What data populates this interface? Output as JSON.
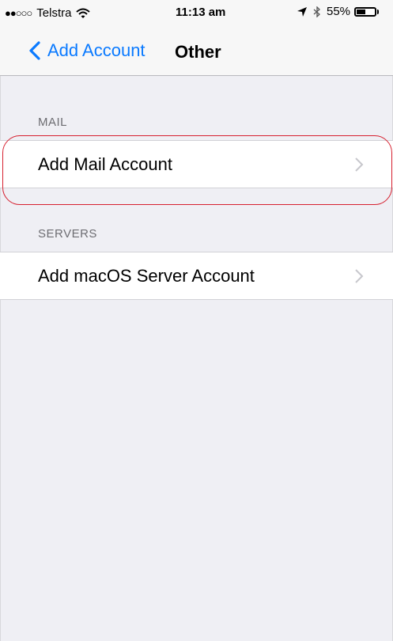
{
  "status_bar": {
    "signal": "●●○○○",
    "carrier": "Telstra",
    "time": "11:13 am",
    "battery": "55%",
    "battery_level": 0.55,
    "icons": [
      "wifi-icon",
      "location-icon",
      "bluetooth-icon",
      "battery-icon"
    ]
  },
  "nav": {
    "back_label": "Add Account",
    "title": "Other"
  },
  "sections": [
    {
      "header": "MAIL",
      "rows": [
        {
          "label": "Add Mail Account"
        }
      ]
    },
    {
      "header": "SERVERS",
      "rows": [
        {
          "label": "Add macOS Server Account"
        }
      ]
    }
  ],
  "colors": {
    "accent": "#0a7aff",
    "background": "#efeff4",
    "highlight": "#d6202f"
  }
}
